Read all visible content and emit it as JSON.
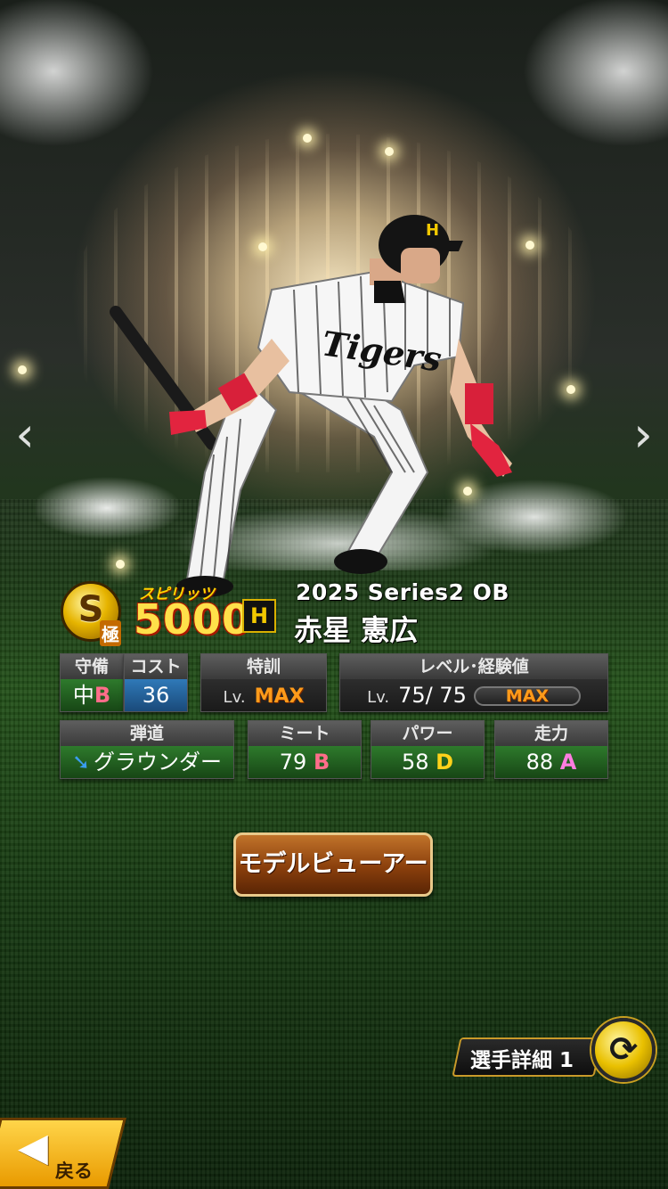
{
  "nav": {
    "prev_glyph": "‹",
    "next_glyph": "›"
  },
  "header": {
    "rank": "S",
    "rank_sub": "極",
    "spirits_label": "スピリッツ",
    "spirits_value": "5000",
    "team_logo": "H",
    "series": "2025 Series2 OB",
    "player_name": "赤星 憲広"
  },
  "stats": {
    "position": {
      "label": "守備",
      "value": "中",
      "grade": "B"
    },
    "cost": {
      "label": "コスト",
      "value": "36"
    },
    "training": {
      "label": "特訓",
      "lv_prefix": "Lv.",
      "value": "MAX"
    },
    "level": {
      "label": "レベル･経験値",
      "lv_prefix": "Lv.",
      "current": "75",
      "separator": "/",
      "max": "75",
      "bar_text": "MAX"
    },
    "trajectory": {
      "label": "弾道",
      "value": "グラウンダー",
      "icon": "arrow-down-right-icon"
    },
    "contact": {
      "label": "ミート",
      "value": "79",
      "grade": "B"
    },
    "power": {
      "label": "パワー",
      "value": "58",
      "grade": "D"
    },
    "speed": {
      "label": "走力",
      "value": "88",
      "grade": "A"
    }
  },
  "buttons": {
    "model_viewer": "モデルビューアー",
    "player_detail": "選手詳細 1",
    "back": "戻る"
  },
  "colors": {
    "accent_gold": "#ffe04a",
    "button_brown": "#8a3f0c",
    "grade_b": "#ff6d8a",
    "grade_d": "#ffd21a",
    "grade_a": "#ff7de0",
    "max_orange": "#ff9b1a"
  }
}
